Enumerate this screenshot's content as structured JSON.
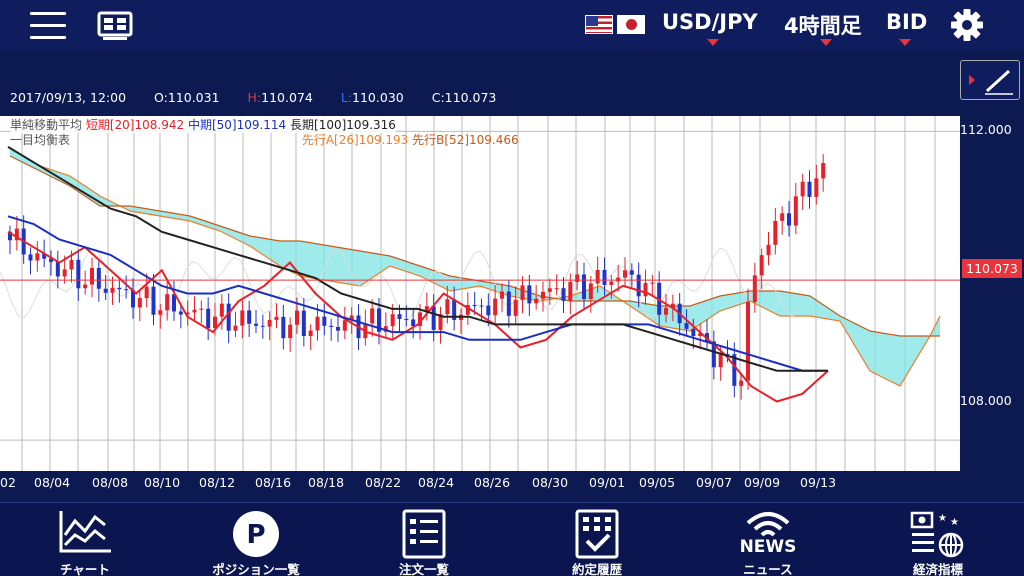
{
  "header": {
    "pair": "USD/JPY",
    "timeframe": "4時間足",
    "price_type": "BID"
  },
  "ohlc": {
    "datetime": "2017/09/13, 12:00",
    "open_label": "O:",
    "open": "110.031",
    "high_label": "H:",
    "high": "110.074",
    "low_label": "L:",
    "low": "110.030",
    "close_label": "C:",
    "close": "110.073"
  },
  "legend": {
    "sma_title": "単純移動平均",
    "sma_short": "短期[20]108.942",
    "sma_mid": "中期[50]109.114",
    "sma_long": "長期[100]109.316",
    "ichimoku_title": "一目均衡表",
    "span_a": "先行A[26]109.193",
    "span_b": "先行B[52]109.466"
  },
  "axis": {
    "y_ticks": [
      "112.000",
      "108.000"
    ],
    "current_price": "110.073",
    "x_ticks": [
      "02",
      "08/04",
      "08/08",
      "08/10",
      "08/12",
      "08/16",
      "08/18",
      "08/22",
      "08/24",
      "08/26",
      "08/30",
      "09/01",
      "09/05",
      "09/07",
      "09/09",
      "09/13"
    ]
  },
  "nav": {
    "chart": "チャート",
    "positions": "ポジション一覧",
    "orders": "注文一覧",
    "history": "約定履歴",
    "news_big": "NEWS",
    "news": "ニュース",
    "indicators": "経済指標"
  },
  "colors": {
    "accent": "#e8343a",
    "background": "#0d1a52",
    "up": "#e8202a",
    "down": "#2233cc",
    "sma_short": "#e8202a",
    "sma_mid": "#1a2fc0",
    "sma_long": "#222222",
    "span_a": "#f07d2a",
    "span_b": "#c85a1a",
    "cloud_up": "#7fe3e3",
    "cloud_down": "#f3b27d"
  },
  "chart_data": {
    "type": "line",
    "title": "USD/JPY 4時間足 BID",
    "ylim": [
      107.6,
      112.2
    ],
    "y_ticks": [
      112.0,
      108.0
    ],
    "current_price": 110.073,
    "series": [
      {
        "name": "短期[20]",
        "values": [
          110.7,
          110.5,
          110.3,
          110.5,
          110.2,
          109.9,
          110.2,
          109.6,
          109.4,
          109.8,
          110.0,
          110.3,
          109.9,
          109.6,
          109.4,
          109.3,
          109.5,
          109.9,
          109.7,
          109.5,
          109.2,
          109.3,
          109.6,
          109.8,
          110.0,
          109.9,
          109.7,
          109.4,
          109.1,
          108.7,
          108.5,
          108.6,
          108.9
        ]
      },
      {
        "name": "中期[50]",
        "values": [
          110.9,
          110.8,
          110.6,
          110.5,
          110.4,
          110.2,
          110.0,
          109.9,
          109.9,
          110.0,
          109.9,
          109.8,
          109.7,
          109.6,
          109.5,
          109.4,
          109.4,
          109.4,
          109.3,
          109.3,
          109.3,
          109.4,
          109.5,
          109.5,
          109.5,
          109.5,
          109.4,
          109.3,
          109.2,
          109.1,
          109.0,
          108.9,
          108.9
        ]
      },
      {
        "name": "長期[100]",
        "values": [
          111.8,
          111.6,
          111.4,
          111.2,
          111.0,
          110.9,
          110.7,
          110.6,
          110.5,
          110.4,
          110.3,
          110.2,
          110.1,
          109.9,
          109.8,
          109.7,
          109.7,
          109.6,
          109.6,
          109.5,
          109.5,
          109.5,
          109.5,
          109.5,
          109.5,
          109.4,
          109.3,
          109.2,
          109.1,
          109.0,
          108.9,
          108.9,
          108.9
        ]
      }
    ]
  }
}
